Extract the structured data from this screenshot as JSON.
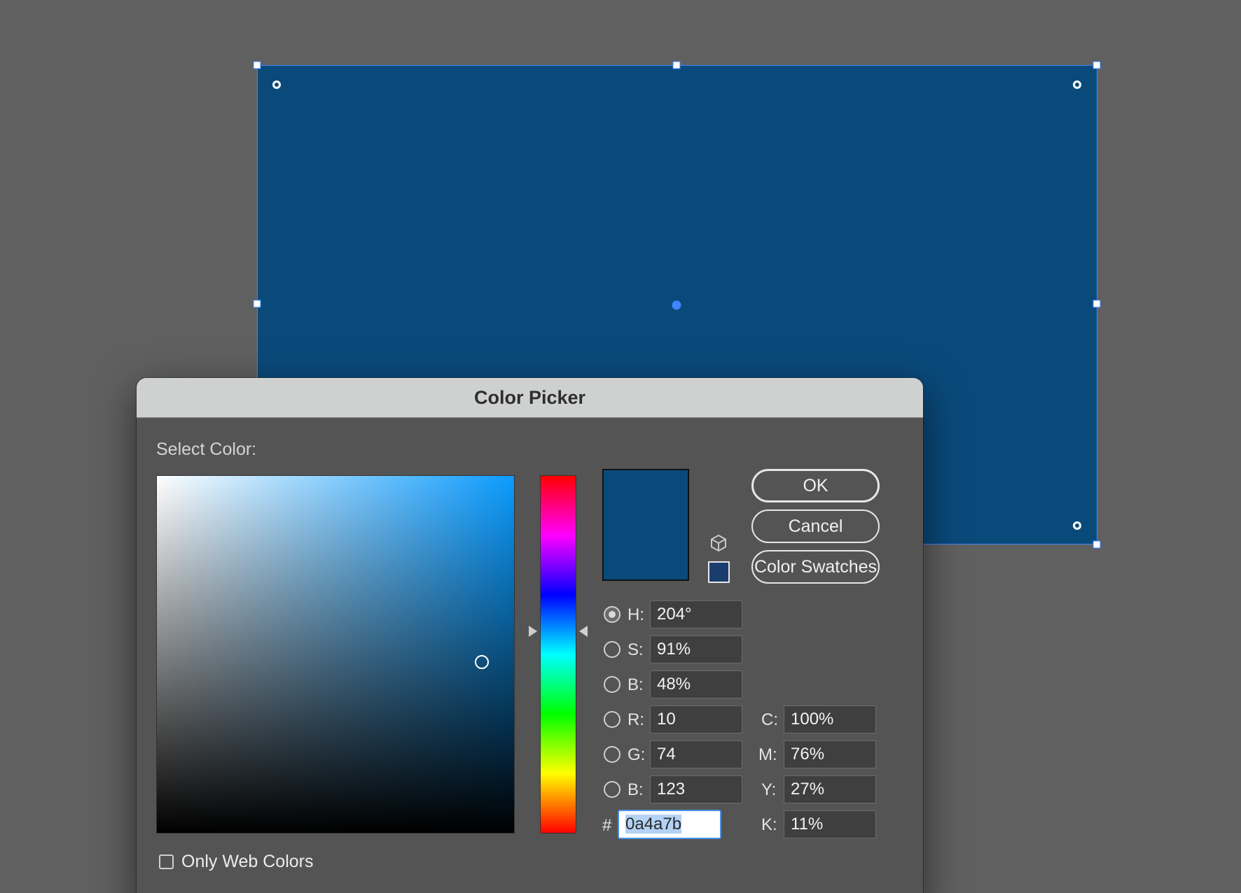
{
  "canvas": {
    "fill_color": "#0a4a7b",
    "selection_color": "#3d86ff"
  },
  "dialog": {
    "title": "Color Picker",
    "select_color_label": "Select Color:",
    "current_color": "#0a4a7b",
    "gamut_warning_color": "#1a3d6e",
    "buttons": {
      "ok": "OK",
      "cancel": "Cancel",
      "swatches": "Color Swatches"
    },
    "hsb": {
      "h_label": "H:",
      "h_value": "204°",
      "s_label": "S:",
      "s_value": "91%",
      "b_label": "B:",
      "b_value": "48%",
      "selected": "H"
    },
    "rgb": {
      "r_label": "R:",
      "r_value": "10",
      "g_label": "G:",
      "g_value": "74",
      "b_label": "B:",
      "b_value": "123"
    },
    "cmyk": {
      "c_label": "C:",
      "c_value": "100%",
      "m_label": "M:",
      "m_value": "76%",
      "y_label": "Y:",
      "y_value": "27%",
      "k_label": "K:",
      "k_value": "11%"
    },
    "hex": {
      "label": "#",
      "value": "0a4a7b"
    },
    "web_colors": {
      "label": "Only Web Colors",
      "checked": false
    },
    "icons": {
      "gamut": "cube-icon"
    }
  }
}
